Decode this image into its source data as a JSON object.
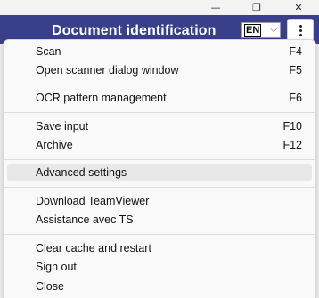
{
  "window": {
    "minimize_glyph": "—",
    "restore_glyph": "❐",
    "close_glyph": "✕"
  },
  "header": {
    "title": "Document identification",
    "language_selected": "EN",
    "background": "#3a3f8c"
  },
  "menu": {
    "items": [
      {
        "label": "Scan",
        "shortcut": "F4"
      },
      {
        "label": "Open scanner dialog window",
        "shortcut": "F5"
      },
      {
        "label": "OCR pattern management",
        "shortcut": "F6"
      },
      {
        "label": "Save input",
        "shortcut": "F10"
      },
      {
        "label": "Archive",
        "shortcut": "F12"
      },
      {
        "label": "Advanced settings",
        "shortcut": ""
      },
      {
        "label": "Download TeamViewer",
        "shortcut": ""
      },
      {
        "label": "Assistance avec TS",
        "shortcut": ""
      },
      {
        "label": "Clear cache and restart",
        "shortcut": ""
      },
      {
        "label": "Sign out",
        "shortcut": ""
      },
      {
        "label": "Close",
        "shortcut": ""
      }
    ],
    "highlighted": "Advanced settings"
  }
}
